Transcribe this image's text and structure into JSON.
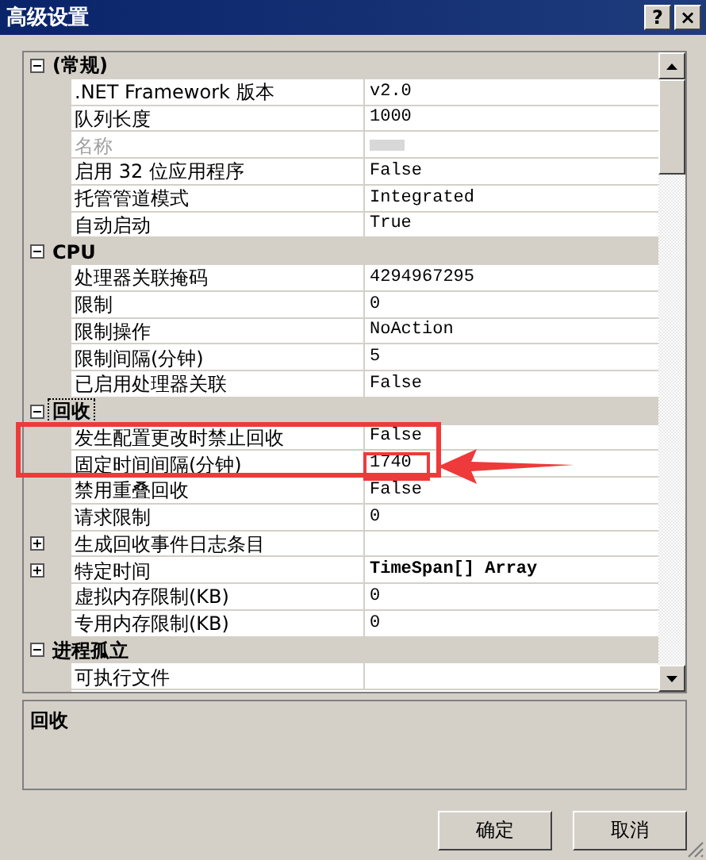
{
  "window": {
    "title": "高级设置",
    "buttons": [
      "?",
      "×"
    ]
  },
  "rows": [
    {
      "kind": "group",
      "label": "(常规)",
      "expanded": true,
      "selected": false
    },
    {
      "kind": "property",
      "label": ".NET Framework 版本",
      "value": "v2.0",
      "disabled": false
    },
    {
      "kind": "property",
      "label": "队列长度",
      "value": "1000",
      "disabled": false
    },
    {
      "kind": "property",
      "label": "名称",
      "disabled": true
    },
    {
      "kind": "property",
      "label": "启用 32 位应用程序",
      "value": "False",
      "disabled": false
    },
    {
      "kind": "property",
      "label": "托管管道模式",
      "value": "Integrated",
      "disabled": false
    },
    {
      "kind": "property",
      "label": "自动启动",
      "value": "True",
      "disabled": false
    },
    {
      "kind": "group",
      "label": "CPU",
      "expanded": true,
      "selected": false
    },
    {
      "kind": "property",
      "label": "处理器关联掩码",
      "value": "4294967295",
      "disabled": false
    },
    {
      "kind": "property",
      "label": "限制",
      "value": "0",
      "disabled": false
    },
    {
      "kind": "property",
      "label": "限制操作",
      "value": "NoAction",
      "disabled": false
    },
    {
      "kind": "property",
      "label": "限制间隔(分钟)",
      "value": "5",
      "disabled": false
    },
    {
      "kind": "property",
      "label": "已启用处理器关联",
      "value": "False",
      "disabled": false
    },
    {
      "kind": "group",
      "label": "回收",
      "expanded": true,
      "selected": true
    },
    {
      "kind": "property",
      "label": "发生配置更改时禁止回收",
      "value": "False",
      "disabled": false
    },
    {
      "kind": "property",
      "label": "固定时间间隔(分钟)",
      "value": "1740",
      "disabled": false
    },
    {
      "kind": "property",
      "label": "禁用重叠回收",
      "value": "False",
      "disabled": false
    },
    {
      "kind": "property",
      "label": "请求限制",
      "value": "0",
      "disabled": false
    },
    {
      "kind": "property",
      "label": "生成回收事件日志条目",
      "expanded": false,
      "disabled": false
    },
    {
      "kind": "array",
      "label": "特定时间",
      "value": "TimeSpan[] Array",
      "expanded": false,
      "disabled": false
    },
    {
      "kind": "property",
      "label": "虚拟内存限制(KB)",
      "value": "0",
      "disabled": false
    },
    {
      "kind": "property",
      "label": "专用内存限制(KB)",
      "value": "0",
      "disabled": false
    },
    {
      "kind": "group",
      "label": "进程孤立",
      "expanded": true,
      "selected": false
    },
    {
      "kind": "property",
      "label": "可执行文件",
      "disabled": false
    }
  ],
  "description": {
    "title": "回收"
  },
  "buttons": [
    "确定",
    "取消"
  ]
}
